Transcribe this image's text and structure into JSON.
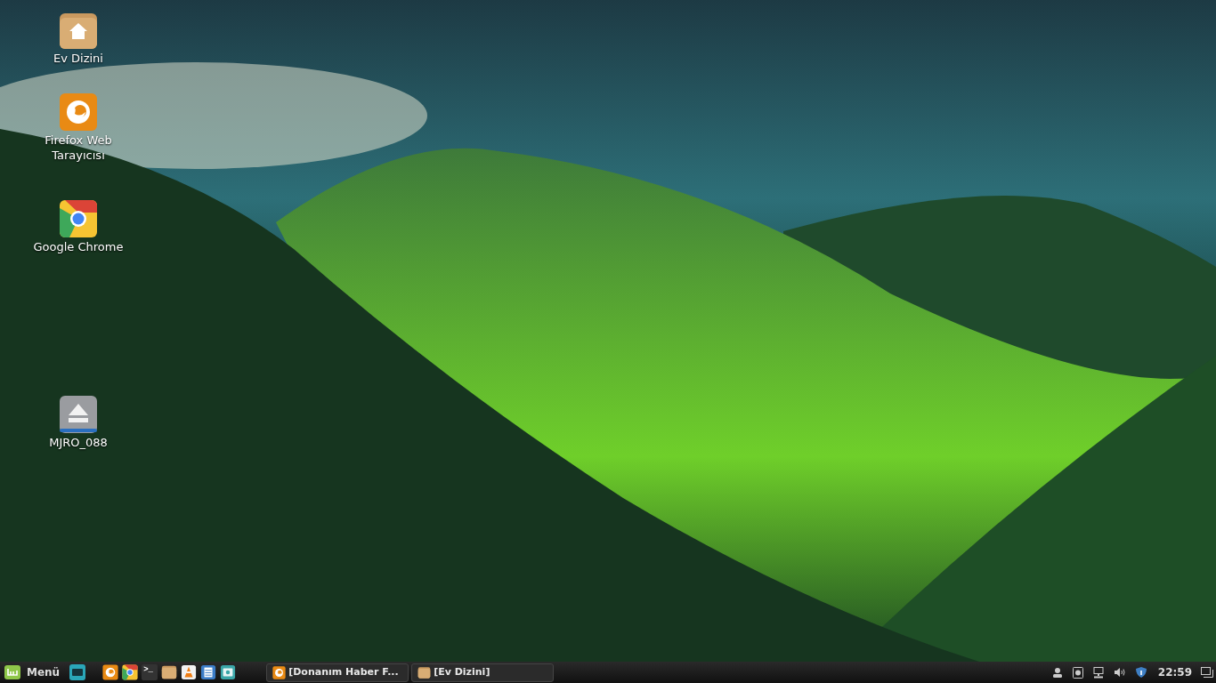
{
  "desktop_icons": [
    {
      "kind": "home",
      "label": "Ev Dizini"
    },
    {
      "kind": "firefox",
      "label": "Firefox Web Tarayıcısı"
    },
    {
      "kind": "chrome",
      "label": "Google Chrome"
    },
    {
      "kind": "drive",
      "label": "MJRO_088"
    }
  ],
  "panel": {
    "menu_label": "Menü",
    "launchers": [
      {
        "kind": "desktop"
      },
      {
        "kind": "firefox"
      },
      {
        "kind": "chrome"
      },
      {
        "kind": "terminal",
        "glyph": ">_"
      },
      {
        "kind": "folder"
      },
      {
        "kind": "vlc"
      },
      {
        "kind": "document"
      },
      {
        "kind": "screenshot"
      }
    ],
    "windows": [
      {
        "kind": "firefox",
        "title": "[Donanım Haber F..."
      },
      {
        "kind": "folder",
        "title": "[Ev Dizini]"
      }
    ],
    "tray": [
      {
        "kind": "user"
      },
      {
        "kind": "update"
      },
      {
        "kind": "network"
      },
      {
        "kind": "volume"
      },
      {
        "kind": "shield"
      }
    ],
    "clock": "22:59"
  }
}
